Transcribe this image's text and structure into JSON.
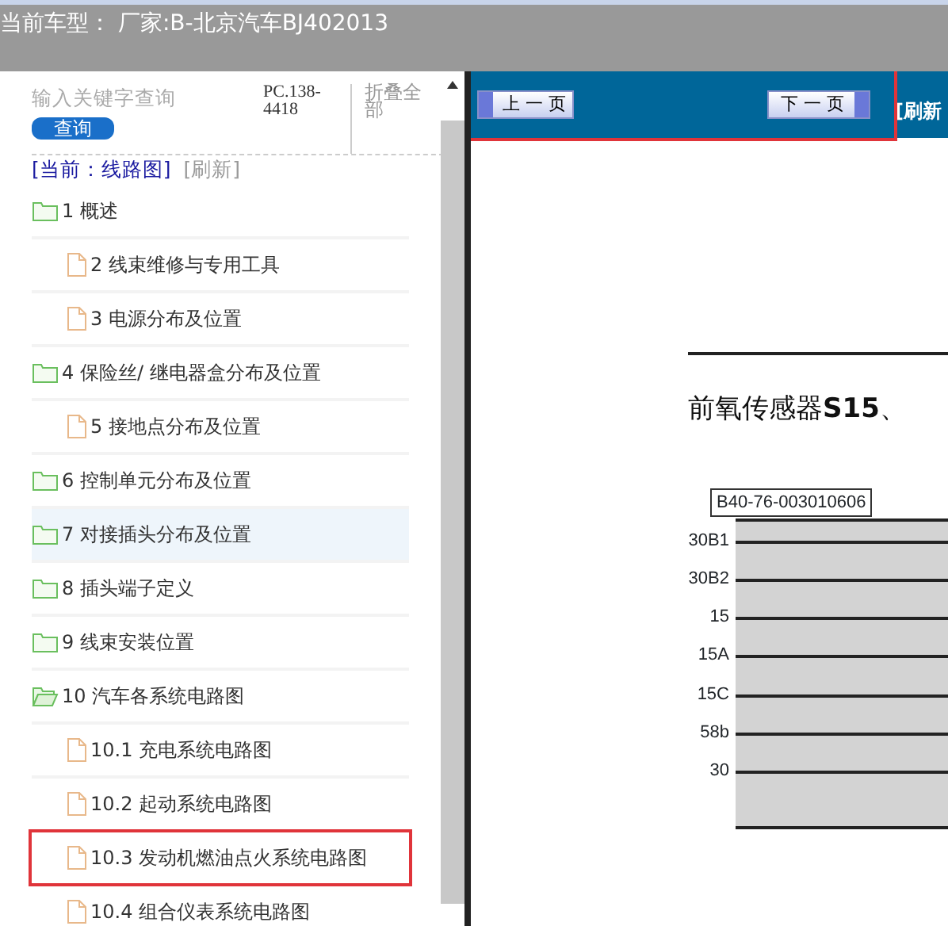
{
  "header": {
    "title": "当前车型： 厂家:B-北京汽车BJ402013"
  },
  "sidebar": {
    "search": {
      "placeholder": "输入关键字查询"
    },
    "search_button": "查询",
    "phone": "PC.138-4418",
    "collapse_all": "折叠全部",
    "current": "[当前：线路图]",
    "refresh": "[刷新]",
    "tree": [
      {
        "label": "1 概述",
        "kind": "folder",
        "expanded": false,
        "selected": false,
        "highlighted": false,
        "children": [
          {
            "label": "2 线束维修与专用工具",
            "kind": "page",
            "selected": false,
            "highlighted": false
          },
          {
            "label": "3 电源分布及位置",
            "kind": "page",
            "selected": false,
            "highlighted": false
          }
        ]
      },
      {
        "label": "4 保险丝/ 继电器盒分布及位置",
        "kind": "folder",
        "expanded": false,
        "selected": false,
        "highlighted": false,
        "children": [
          {
            "label": "5 接地点分布及位置",
            "kind": "page",
            "selected": false,
            "highlighted": false
          }
        ]
      },
      {
        "label": "6 控制单元分布及位置",
        "kind": "folder",
        "expanded": false,
        "selected": false,
        "highlighted": false
      },
      {
        "label": "7 对接插头分布及位置",
        "kind": "folder",
        "expanded": false,
        "selected": true,
        "highlighted": false
      },
      {
        "label": "8 插头端子定义",
        "kind": "folder",
        "expanded": false,
        "selected": false,
        "highlighted": false
      },
      {
        "label": "9 线束安装位置",
        "kind": "folder",
        "expanded": false,
        "selected": false,
        "highlighted": false
      },
      {
        "label": "10 汽车各系统电路图",
        "kind": "folder",
        "expanded": true,
        "selected": false,
        "highlighted": false,
        "children": [
          {
            "label": "10.1 充电系统电路图",
            "kind": "page",
            "selected": false,
            "highlighted": false
          },
          {
            "label": "10.2 起动系统电路图",
            "kind": "page",
            "selected": false,
            "highlighted": false
          },
          {
            "label": "10.3 发动机燃油点火系统电路图",
            "kind": "page",
            "selected": false,
            "highlighted": true
          },
          {
            "label": "10.4 组合仪表系统电路图",
            "kind": "page",
            "selected": false,
            "highlighted": false
          }
        ]
      }
    ]
  },
  "pager": {
    "highlighted": true,
    "prev": "上 一 页",
    "next": "下 一 页",
    "refresh": "[刷新"
  },
  "diagram": {
    "title": "前氧传感器**S15**、",
    "connector": "B40-76-003010606",
    "wires": [
      "30B1",
      "30B2",
      "15",
      "15A",
      "15C",
      "58b",
      "30"
    ]
  }
}
